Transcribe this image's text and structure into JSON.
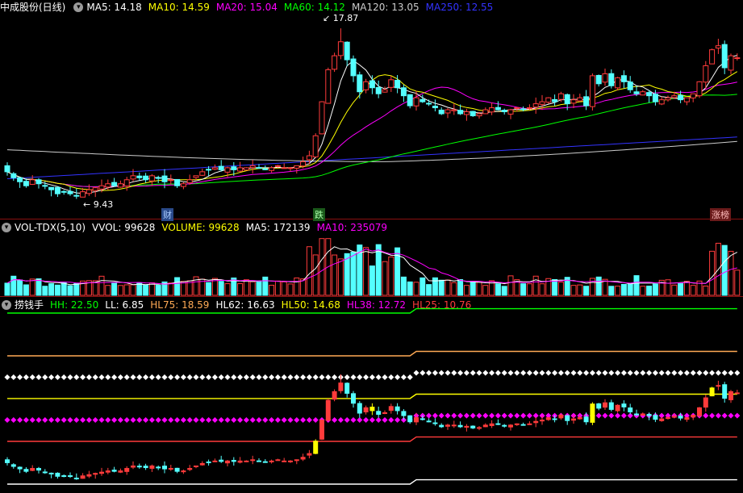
{
  "colors": {
    "up": "#ff3b3b",
    "down": "#54ffff",
    "ma5": "#ffffff",
    "ma10": "#ffff00",
    "ma20": "#ff00ff",
    "ma60": "#00ff00",
    "ma120": "#cccccc",
    "ma250": "#3333ff",
    "vol": "#ffffff",
    "volume": "#ffff00",
    "volma5": "#ffffff",
    "volma10": "#ff00ff"
  },
  "main": {
    "title": "中成股份(日线)",
    "ma_labels": [
      {
        "text": "MA5: 14.18",
        "color": "#ffffff"
      },
      {
        "text": "MA10: 14.59",
        "color": "#ffff00"
      },
      {
        "text": "MA20: 15.04",
        "color": "#ff00ff"
      },
      {
        "text": "MA60: 14.12",
        "color": "#00ff00"
      },
      {
        "text": "MA120: 13.05",
        "color": "#cccccc"
      },
      {
        "text": "MA250: 12.55",
        "color": "#3333ff"
      }
    ],
    "high_label": "17.87",
    "low_label": "9.43",
    "events": [
      {
        "text": "财",
        "bg": "#2a4a8a",
        "fg": "#aaccff"
      },
      {
        "text": "跌",
        "bg": "#1a5a1a",
        "fg": "#aaffaa"
      },
      {
        "text": "涨榜",
        "bg": "#6a1a1a",
        "fg": "#ffbbbb"
      }
    ]
  },
  "volume": {
    "labels": [
      {
        "text": "VOL-TDX(5,10)",
        "color": "#ffffff"
      },
      {
        "text": "VVOL: 99628",
        "color": "#ffffff"
      },
      {
        "text": "VOLUME: 99628",
        "color": "#ffff00"
      },
      {
        "text": "MA5: 172139",
        "color": "#ffffff"
      },
      {
        "text": "MA10: 235079",
        "color": "#ff00ff"
      }
    ]
  },
  "indicator": {
    "labels": [
      {
        "text": "捞钱手",
        "color": "#ffffff"
      },
      {
        "text": "HH: 22.50",
        "color": "#00ff00"
      },
      {
        "text": "LL: 6.85",
        "color": "#ffffff"
      },
      {
        "text": "HL75: 18.59",
        "color": "#ffaa55"
      },
      {
        "text": "HL62: 16.63",
        "color": "#ffffff"
      },
      {
        "text": "HL50: 14.68",
        "color": "#ffff00"
      },
      {
        "text": "HL38: 12.72",
        "color": "#ff00ff"
      },
      {
        "text": "HL25: 10.76",
        "color": "#ff3b3b"
      }
    ]
  },
  "chart_data": {
    "type": "candlestick",
    "price_range": [
      9.0,
      18.4
    ],
    "closes": [
      10.7,
      10.4,
      10.2,
      10.0,
      10.3,
      10.1,
      10.0,
      9.8,
      9.6,
      9.7,
      9.6,
      9.5,
      9.7,
      9.8,
      9.9,
      10.0,
      10.1,
      10.0,
      10.1,
      10.3,
      10.5,
      10.4,
      10.3,
      10.5,
      10.4,
      10.2,
      10.3,
      10.0,
      10.1,
      10.3,
      10.5,
      10.7,
      10.8,
      10.9,
      10.8,
      10.9,
      10.8,
      10.9,
      10.9,
      11.0,
      10.9,
      10.8,
      10.9,
      11.0,
      10.9,
      10.9,
      11.0,
      11.2,
      11.5,
      12.5,
      14.2,
      15.8,
      16.5,
      17.2,
      16.3,
      15.5,
      14.7,
      15.2,
      14.9,
      14.6,
      14.8,
      15.3,
      14.9,
      14.5,
      14.0,
      14.4,
      14.2,
      14.1,
      13.9,
      13.6,
      13.8,
      13.8,
      13.6,
      13.7,
      13.5,
      13.6,
      13.8,
      13.9,
      13.8,
      13.7,
      13.8,
      13.9,
      13.8,
      13.9,
      14.1,
      14.2,
      14.4,
      14.2,
      14.6,
      14.1,
      14.3,
      14.4,
      14.0,
      15.5,
      15.1,
      15.6,
      15.0,
      15.4,
      15.2,
      14.8,
      14.6,
      14.7,
      14.5,
      14.2,
      14.3,
      14.4,
      14.5,
      14.3,
      14.4,
      14.6,
      15.2,
      16.0,
      16.8,
      17.0,
      15.9,
      16.5,
      16.4
    ]
  }
}
